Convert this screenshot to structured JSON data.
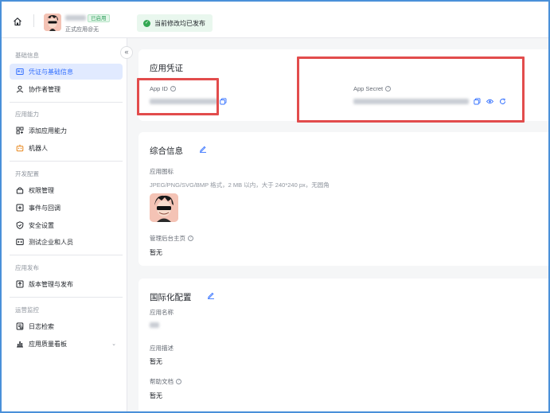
{
  "header": {
    "subtitle": "正式应用@无",
    "status_tag": "已启用",
    "publish_notice": "当前修改均已发布"
  },
  "sidebar": {
    "sections": [
      {
        "title": "基础信息",
        "items": [
          {
            "label": "凭证与基础信息",
            "icon": "credential-icon",
            "active": true
          },
          {
            "label": "协作者管理",
            "icon": "user-icon"
          }
        ]
      },
      {
        "title": "应用能力",
        "items": [
          {
            "label": "添加应用能力",
            "icon": "grid-plus-icon"
          },
          {
            "label": "机器人",
            "icon": "robot-icon"
          }
        ]
      },
      {
        "title": "开发配置",
        "items": [
          {
            "label": "权限管理",
            "icon": "lock-icon"
          },
          {
            "label": "事件与回调",
            "icon": "event-icon"
          },
          {
            "label": "安全设置",
            "icon": "shield-icon"
          },
          {
            "label": "测试企业和人员",
            "icon": "code-icon"
          }
        ]
      },
      {
        "title": "应用发布",
        "items": [
          {
            "label": "版本管理与发布",
            "icon": "upload-icon"
          }
        ]
      },
      {
        "title": "运营监控",
        "items": [
          {
            "label": "日志检索",
            "icon": "log-icon"
          },
          {
            "label": "应用质量看板",
            "icon": "bar-chart-icon",
            "has_chevron": true
          }
        ]
      }
    ]
  },
  "credentials": {
    "title": "应用凭证",
    "app_id_label": "App ID",
    "app_secret_label": "App Secret"
  },
  "general": {
    "title": "综合信息",
    "icon_label": "应用图标",
    "icon_hint": "JPEG/PNG/SVG/BMP 格式，2 MB 以内，大于 240*240 px，无圆角",
    "homepage_label": "管理后台主页",
    "homepage_value": "暂无"
  },
  "i18n": {
    "title": "国际化配置",
    "name_label": "应用名称",
    "desc_label": "应用描述",
    "desc_value": "暂无",
    "help_label": "帮助文档",
    "help_value": "暂无"
  },
  "colors": {
    "accent": "#3370ff",
    "highlight": "#e24c4c",
    "success": "#34a853"
  }
}
